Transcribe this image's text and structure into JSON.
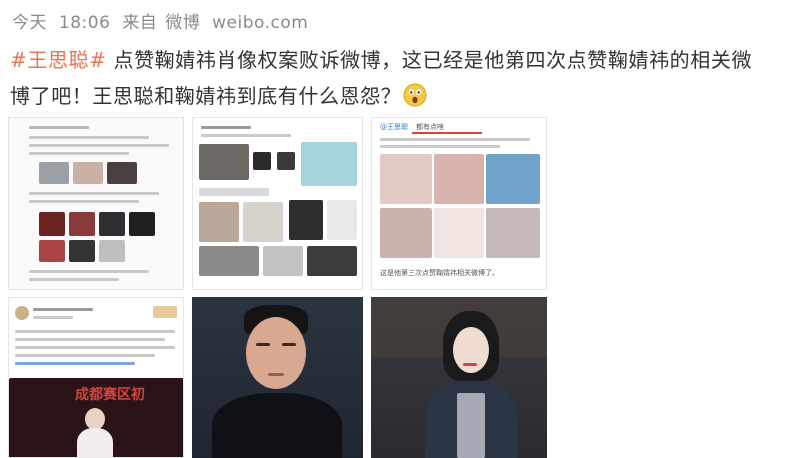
{
  "post": {
    "time_label": "今天",
    "time": "18:06",
    "source_prefix": "来自",
    "source": "微博",
    "site": "weibo.com",
    "hashtag": "#王思聪#",
    "text_line1": " 点赞鞠婧祎肖像权案败诉微博，这已经是他第四次点赞鞠婧祎的相关微",
    "text_line2": "博了吧！王思聪和鞠婧祎到底有什么恩怨？",
    "emoji": "surprised-face-emoji"
  },
  "images": {
    "tile3_header": "@王思聪",
    "tile3_title": "都有点啥",
    "tile3_footer": "这是他第三次点赞鞠婧祎相关微博了。",
    "tile4_banner": "成都赛区初"
  },
  "colors": {
    "hashtag": "#eb7350",
    "meta": "#8a8a8a",
    "text": "#333333"
  }
}
